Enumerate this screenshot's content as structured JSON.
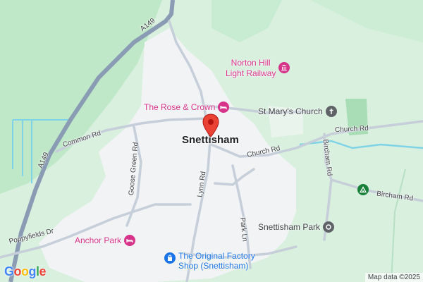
{
  "map": {
    "town_name": "Snettisham",
    "attribution": "Map data ©2025",
    "logo_letters": [
      "G",
      "o",
      "o",
      "g",
      "l",
      "e"
    ],
    "logo_colors": [
      "#4285f4",
      "#ea4335",
      "#fbbc05",
      "#4285f4",
      "#34a853",
      "#ea4335"
    ],
    "colors": {
      "land": "#d9f0df",
      "urban": "#f1f3f4",
      "forest": "#bfe8c8",
      "water": "#7fd3e6",
      "major_road": "#8a9bb4",
      "minor_road": "#c6cfd9",
      "marker": "#ea4335",
      "poi_pink": "#d6338a",
      "poi_blue": "#1a73e8",
      "poi_green": "#188038",
      "poi_grey": "#5f6368"
    },
    "roads": {
      "a149_top": "A149",
      "a149_left": "A149",
      "common_rd": "Common Rd",
      "goose_green_rd": "Goose Green Rd",
      "lynn_rd": "Lynn Rd",
      "church_rd_mid": "Church Rd",
      "church_rd_right": "Church Rd",
      "bircham_rd_vert": "Bircham Rd",
      "bircham_rd_horiz": "Bircham Rd",
      "park_ln": "Park Ln",
      "poppyfields_dr": "Poppyfields Dr"
    },
    "pois": {
      "norton_hill_line1": "Norton Hill",
      "norton_hill_line2": "Light Railway",
      "norton_hill_icon": "museum-icon",
      "rose_crown": "The Rose & Crown",
      "rose_crown_icon": "bed-icon",
      "st_marys": "St Mary's Church",
      "st_marys_icon": "church-cross-icon",
      "campsite_icon": "campsite-tent-icon",
      "snettisham_park": "Snettisham Park",
      "snettisham_park_icon": "place-dot-icon",
      "anchor_park": "Anchor Park",
      "anchor_park_icon": "bed-icon",
      "factory_shop_line1": "The Original Factory",
      "factory_shop_line2": "Shop (Snettisham)",
      "factory_shop_icon": "shopping-bag-icon"
    }
  }
}
